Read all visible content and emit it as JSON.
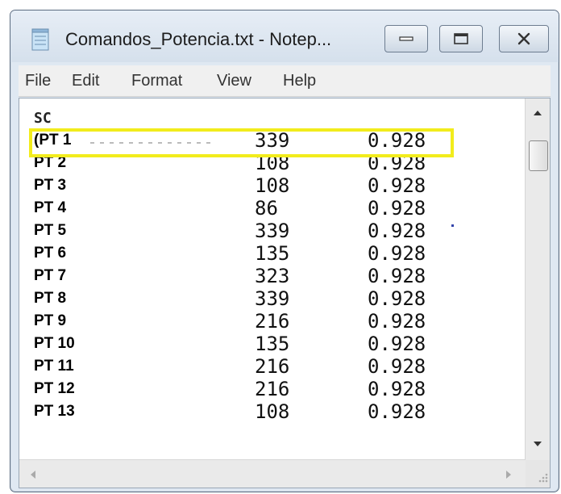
{
  "window": {
    "title": "Comandos_Potencia.txt - Notep..."
  },
  "menu": [
    "File",
    "Edit",
    "Format",
    "View",
    "Help"
  ],
  "document": {
    "header": "SC",
    "rows": [
      {
        "label": "(PT 1",
        "value": "339",
        "pf": "0.928"
      },
      {
        "label": "PT 2",
        "value": "108",
        "pf": "0.928"
      },
      {
        "label": "PT 3",
        "value": "108",
        "pf": "0.928"
      },
      {
        "label": "PT 4",
        "value": "86",
        "pf": "0.928"
      },
      {
        "label": "PT 5",
        "value": "339",
        "pf": "0.928"
      },
      {
        "label": "PT 6",
        "value": "135",
        "pf": "0.928"
      },
      {
        "label": "PT 7",
        "value": "323",
        "pf": "0.928"
      },
      {
        "label": "PT 8",
        "value": "339",
        "pf": "0.928"
      },
      {
        "label": "PT 9",
        "value": "216",
        "pf": "0.928"
      },
      {
        "label": "PT 10",
        "value": "135",
        "pf": "0.928"
      },
      {
        "label": "PT 11",
        "value": "216",
        "pf": "0.928"
      },
      {
        "label": "PT 12",
        "value": "216",
        "pf": "0.928"
      },
      {
        "label": "PT 13",
        "value": "108",
        "pf": "0.928"
      }
    ]
  },
  "highlight_color": "#f2ec1c",
  "icons": {
    "app": "notepad-icon",
    "minimize": "minimize-icon",
    "maximize": "maximize-icon",
    "close": "close-icon"
  }
}
